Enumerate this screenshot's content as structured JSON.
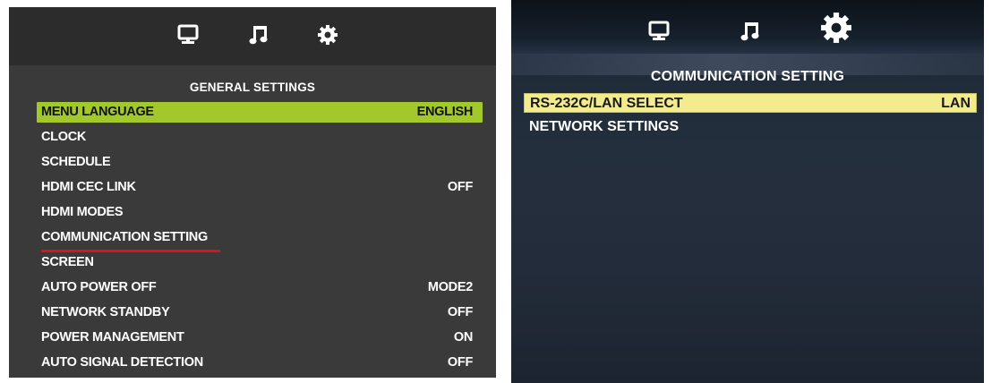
{
  "left_panel": {
    "tabs": [
      {
        "icon": "monitor-icon"
      },
      {
        "icon": "music-note-icon"
      },
      {
        "icon": "gear-icon",
        "active": true
      }
    ],
    "heading": "GENERAL SETTINGS",
    "items": [
      {
        "label": "MENU LANGUAGE",
        "value": "ENGLISH",
        "selected": true
      },
      {
        "label": "CLOCK",
        "value": ""
      },
      {
        "label": "SCHEDULE",
        "value": ""
      },
      {
        "label": "HDMI CEC LINK",
        "value": "OFF"
      },
      {
        "label": "HDMI MODES",
        "value": ""
      },
      {
        "label": "COMMUNICATION SETTING",
        "value": "",
        "underlined": true
      },
      {
        "label": "SCREEN",
        "value": ""
      },
      {
        "label": "AUTO POWER OFF",
        "value": "MODE2"
      },
      {
        "label": "NETWORK STANDBY",
        "value": "OFF"
      },
      {
        "label": "POWER MANAGEMENT",
        "value": "ON"
      },
      {
        "label": "AUTO SIGNAL DETECTION",
        "value": "OFF"
      }
    ],
    "colors": {
      "background": "#3a3a3a",
      "highlight": "#a2c82c",
      "underline": "#d4151d"
    }
  },
  "right_panel": {
    "tabs": [
      {
        "icon": "monitor-icon"
      },
      {
        "icon": "music-note-icon"
      },
      {
        "icon": "gear-icon",
        "active": true
      }
    ],
    "heading": "COMMUNICATION SETTING",
    "items": [
      {
        "label": "RS-232C/LAN SELECT",
        "value": "LAN",
        "selected": true
      },
      {
        "label": "NETWORK SETTINGS",
        "value": ""
      }
    ],
    "colors": {
      "background": "#232c3a",
      "highlight": "#f3ec8e"
    }
  }
}
